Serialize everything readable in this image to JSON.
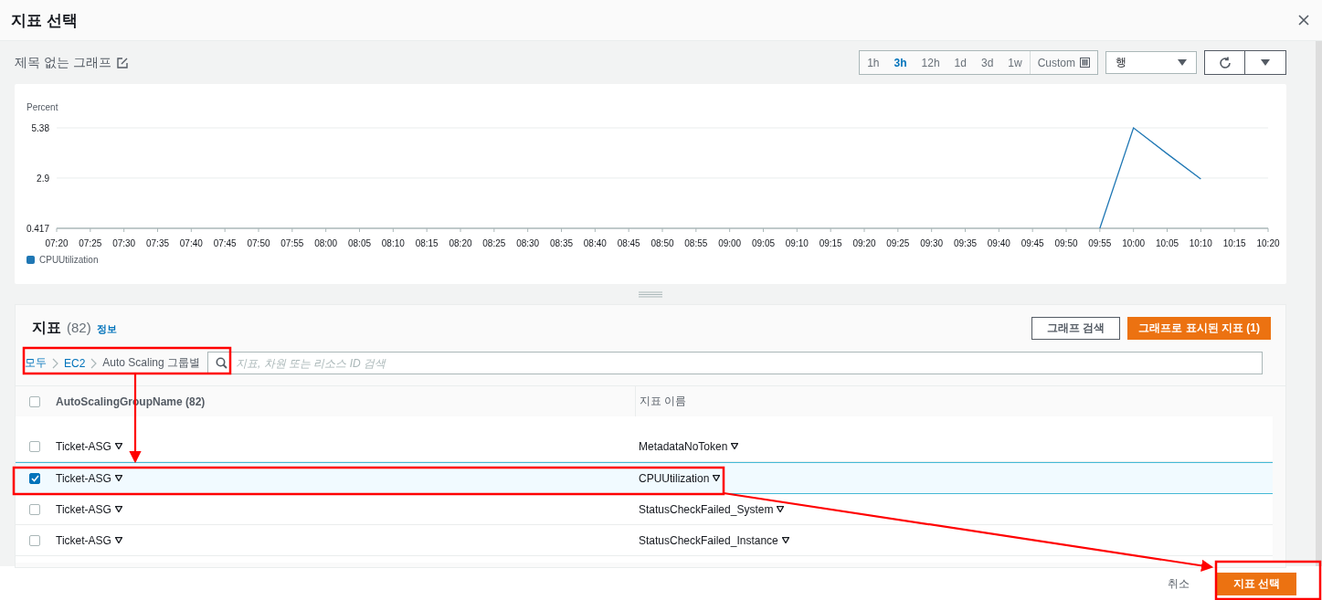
{
  "dialog": {
    "title": "지표 선택"
  },
  "graph": {
    "title": "제목 없는 그래프",
    "time_ranges": [
      {
        "label": "1h",
        "selected": false
      },
      {
        "label": "3h",
        "selected": true
      },
      {
        "label": "12h",
        "selected": false
      },
      {
        "label": "1d",
        "selected": false
      },
      {
        "label": "3d",
        "selected": false
      },
      {
        "label": "1w",
        "selected": false
      }
    ],
    "custom": "Custom",
    "view": "행",
    "chart_data": {
      "type": "line",
      "ylabel": "Percent",
      "categories": [
        "07:20",
        "07:25",
        "07:30",
        "07:35",
        "07:40",
        "07:45",
        "07:50",
        "07:55",
        "08:00",
        "08:05",
        "08:10",
        "08:15",
        "08:20",
        "08:25",
        "08:30",
        "08:35",
        "08:40",
        "08:45",
        "08:50",
        "08:55",
        "09:00",
        "09:05",
        "09:10",
        "09:15",
        "09:20",
        "09:25",
        "09:30",
        "09:35",
        "09:40",
        "09:45",
        "09:50",
        "09:55",
        "10:00",
        "10:05",
        "10:10",
        "10:15",
        "10:20"
      ],
      "ylim": [
        0.417,
        5.38
      ],
      "yticks": [
        0.417,
        2.9,
        5.38
      ],
      "series": [
        {
          "name": "CPUUtilization",
          "color": "#1f77b4",
          "values": [
            null,
            null,
            null,
            null,
            null,
            null,
            null,
            null,
            null,
            null,
            null,
            null,
            null,
            null,
            null,
            null,
            null,
            null,
            null,
            null,
            null,
            null,
            null,
            null,
            null,
            null,
            null,
            null,
            null,
            null,
            null,
            0.417,
            5.38,
            4.1,
            2.85,
            null,
            null
          ]
        }
      ]
    }
  },
  "metrics": {
    "title": "지표",
    "count": "(82)",
    "info": "정보",
    "search_button": "그래프 검색",
    "graphed_button": "그래프로 표시된 지표 (1)",
    "breadcrumb": [
      {
        "label": "모두",
        "link": true
      },
      {
        "label": "EC2",
        "link": true
      },
      {
        "label": "Auto Scaling 그룹별",
        "link": false
      }
    ],
    "search": {
      "placeholder": "지표, 차원 또는 리소스 ID 검색"
    },
    "table": {
      "columns": [
        "AutoScalingGroupName (82)",
        "지표 이름"
      ],
      "header_checked": false,
      "rows": [
        {
          "cells": [
            "Ticket-ASG",
            "MetadataNoToken"
          ],
          "selected": false
        },
        {
          "cells": [
            "Ticket-ASG",
            "CPUUtilization"
          ],
          "selected": true
        },
        {
          "cells": [
            "Ticket-ASG",
            "StatusCheckFailed_System"
          ],
          "selected": false
        },
        {
          "cells": [
            "Ticket-ASG",
            "StatusCheckFailed_Instance"
          ],
          "selected": false
        }
      ]
    }
  },
  "footer": {
    "cancel": "취소",
    "submit": "지표 선택"
  }
}
